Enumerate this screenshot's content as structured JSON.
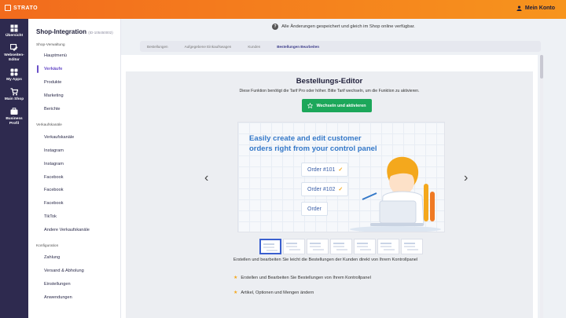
{
  "brand": {
    "logo_text": "STRATO"
  },
  "header": {
    "account_label": "Mein Konto"
  },
  "left_nav": {
    "items": [
      {
        "label": "Übersicht",
        "icon": "grid-icon"
      },
      {
        "label": "Webseiten-Editor",
        "icon": "editor-icon"
      },
      {
        "label": "My Apps",
        "icon": "apps-icon"
      },
      {
        "label": "Main Shop",
        "icon": "cart-icon"
      },
      {
        "label": "Business Profil",
        "icon": "briefcase-icon"
      }
    ]
  },
  "sidebar": {
    "title": "Shop-Integration",
    "title_id": "(ID-105450002)",
    "sections": [
      {
        "label": "Shop-Verwaltung",
        "items": [
          "Hauptmenü",
          "Verkäufe",
          "Produkte",
          "Marketing",
          "Berichte"
        ]
      },
      {
        "label": "Verkaufskanäle",
        "items": [
          "Verkaufskanäle",
          "Instagram",
          "Instagram",
          "Facebook",
          "Facebook",
          "Facebook",
          "TikTok",
          "Andere Verkaufskanäle"
        ]
      },
      {
        "label": "Konfiguration",
        "items": [
          "Zahlung",
          "Versand & Abholung",
          "Einstellungen",
          "Anwendungen"
        ]
      }
    ],
    "active_item": "Verkäufe"
  },
  "notice": {
    "text": "Alle Änderungen gespeichert und gleich im Shop online verfügbar."
  },
  "tabs": [
    {
      "label": "Bestellungen",
      "active": false
    },
    {
      "label": "Aufgegebene Einkaufswagen",
      "active": false
    },
    {
      "label": "Kunden",
      "active": false
    },
    {
      "label": "Bestellungen Bearbeiten",
      "active": true
    }
  ],
  "editor": {
    "title": "Bestellungs-Editor",
    "description": "Diese Funktion benötigt die Tarif Pro oder höher. Bitte Tarif wechseln, um die Funktion zu aktivieren.",
    "cta_label": "Wechseln und aktivieren",
    "hero": {
      "heading_line1": "Easily create and edit customer",
      "heading_line2": "orders right from your control panel",
      "orders": [
        "Order #101",
        "Order #102",
        "Order"
      ]
    },
    "thumbnail_count": 7,
    "active_thumbnail": 0,
    "body_text": "Erstellen und bearbeiten Sie leicht die Bestellungen der Kunden direkt von Ihrem Kontrollpanel",
    "features": [
      "Erstellen und Bearbeiten Sie Bestellungen von Ihrem Kontrollpanel",
      "Artikel, Optionen und Mengen ändern"
    ]
  },
  "colors": {
    "topbar_start": "#f26b1d",
    "topbar_end": "#f7941d",
    "nav_bg": "#2e2a4f",
    "accent": "#6a4fc8",
    "cta_green": "#1ca75a",
    "hero_blue": "#3478c8"
  }
}
